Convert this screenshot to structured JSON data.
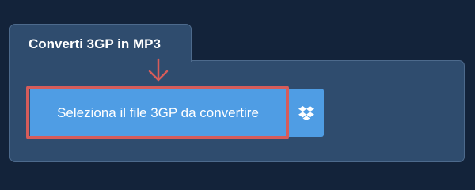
{
  "converter": {
    "tab_title": "Converti 3GP in MP3",
    "select_button_label": "Seleziona il file 3GP da convertire"
  },
  "icons": {
    "pointer": "arrow-down-icon",
    "cloud": "dropbox-icon"
  },
  "colors": {
    "background": "#13233a",
    "panel": "#2f4c6e",
    "button": "#4f9de4",
    "highlight": "#d65c5a"
  }
}
